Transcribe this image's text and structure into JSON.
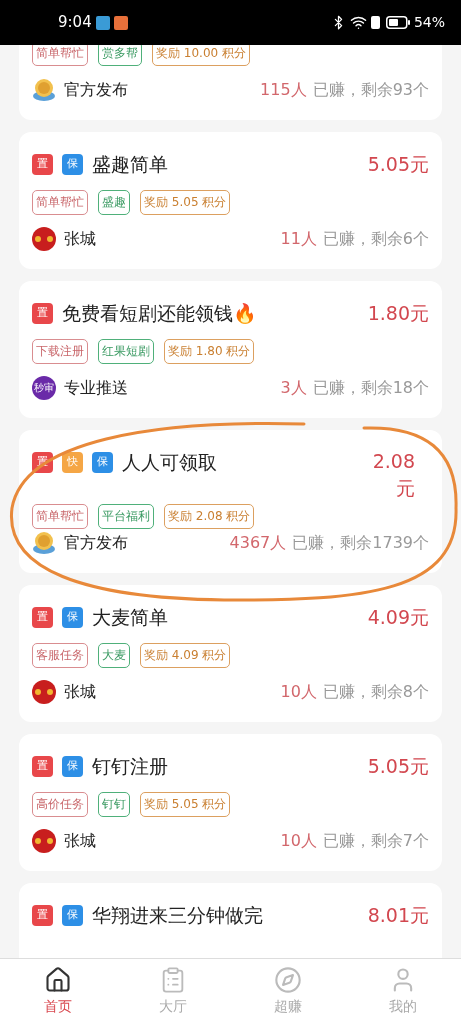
{
  "status_bar": {
    "time": "9:04",
    "battery": "54%"
  },
  "tasks": [
    {
      "tags": [
        {
          "kind": "category",
          "text": "简单帮忙"
        },
        {
          "kind": "platform",
          "text": "赏多帮"
        },
        {
          "kind": "reward",
          "text": "奖励 10.00 积分"
        }
      ],
      "author": {
        "kind": "official",
        "name": "官方发布"
      },
      "earned": "115人",
      "remaining": "已赚，剩余93个",
      "circled": false
    },
    {
      "badges": [
        {
          "kind": "top",
          "text": "置"
        },
        {
          "kind": "guarantee",
          "text": "保"
        }
      ],
      "title": "盛趣简单",
      "price": "5.05元",
      "tags": [
        {
          "kind": "category",
          "text": "简单帮忙"
        },
        {
          "kind": "platform",
          "text": "盛趣"
        },
        {
          "kind": "reward",
          "text": "奖励 5.05 积分"
        }
      ],
      "author": {
        "kind": "red",
        "name": "张城"
      },
      "earned": "11人",
      "remaining": "已赚，剩余6个",
      "circled": false
    },
    {
      "badges": [
        {
          "kind": "top",
          "text": "置"
        }
      ],
      "title": "免费看短剧还能领钱🔥",
      "price": "1.80元",
      "tags": [
        {
          "kind": "category",
          "text": "下载注册"
        },
        {
          "kind": "platform",
          "text": "红果短剧"
        },
        {
          "kind": "reward",
          "text": "奖励 1.80 积分"
        }
      ],
      "author": {
        "kind": "purple",
        "name": "专业推送",
        "avatar_text": "秒审"
      },
      "earned": "3人",
      "remaining": "已赚，剩余18个",
      "circled": false
    },
    {
      "badges": [
        {
          "kind": "top",
          "text": "置"
        },
        {
          "kind": "fast",
          "text": "快"
        },
        {
          "kind": "guarantee",
          "text": "保"
        }
      ],
      "title": "人人可领取",
      "price": "2.08元",
      "tags": [
        {
          "kind": "category",
          "text": "简单帮忙"
        },
        {
          "kind": "platform",
          "text": "平台福利"
        },
        {
          "kind": "reward",
          "text": "奖励 2.08 积分"
        }
      ],
      "author": {
        "kind": "official",
        "name": "官方发布"
      },
      "earned": "4367人",
      "remaining": "已赚，剩余1739个",
      "circled": true
    },
    {
      "badges": [
        {
          "kind": "top",
          "text": "置"
        },
        {
          "kind": "guarantee",
          "text": "保"
        }
      ],
      "title": "大麦简单",
      "price": "4.09元",
      "tags": [
        {
          "kind": "category",
          "text": "客服任务"
        },
        {
          "kind": "platform",
          "text": "大麦"
        },
        {
          "kind": "reward",
          "text": "奖励 4.09 积分"
        }
      ],
      "author": {
        "kind": "red",
        "name": "张城"
      },
      "earned": "10人",
      "remaining": "已赚，剩余8个",
      "circled": false
    },
    {
      "badges": [
        {
          "kind": "top",
          "text": "置"
        },
        {
          "kind": "guarantee",
          "text": "保"
        }
      ],
      "title": "钉钉注册",
      "price": "5.05元",
      "tags": [
        {
          "kind": "category",
          "text": "高价任务"
        },
        {
          "kind": "platform",
          "text": "钉钉"
        },
        {
          "kind": "reward",
          "text": "奖励 5.05 积分"
        }
      ],
      "author": {
        "kind": "red",
        "name": "张城"
      },
      "earned": "10人",
      "remaining": "已赚，剩余7个",
      "circled": false
    },
    {
      "badges": [
        {
          "kind": "top",
          "text": "置"
        },
        {
          "kind": "guarantee",
          "text": "保"
        }
      ],
      "title": "华翔进来三分钟做完",
      "price": "8.01元",
      "circled": false
    }
  ],
  "nav": [
    {
      "kind": "home",
      "label": "首页",
      "selected": true
    },
    {
      "kind": "hall",
      "label": "大厅",
      "selected": false
    },
    {
      "kind": "compass",
      "label": "超赚",
      "selected": false
    },
    {
      "kind": "profile",
      "label": "我的",
      "selected": false
    }
  ]
}
